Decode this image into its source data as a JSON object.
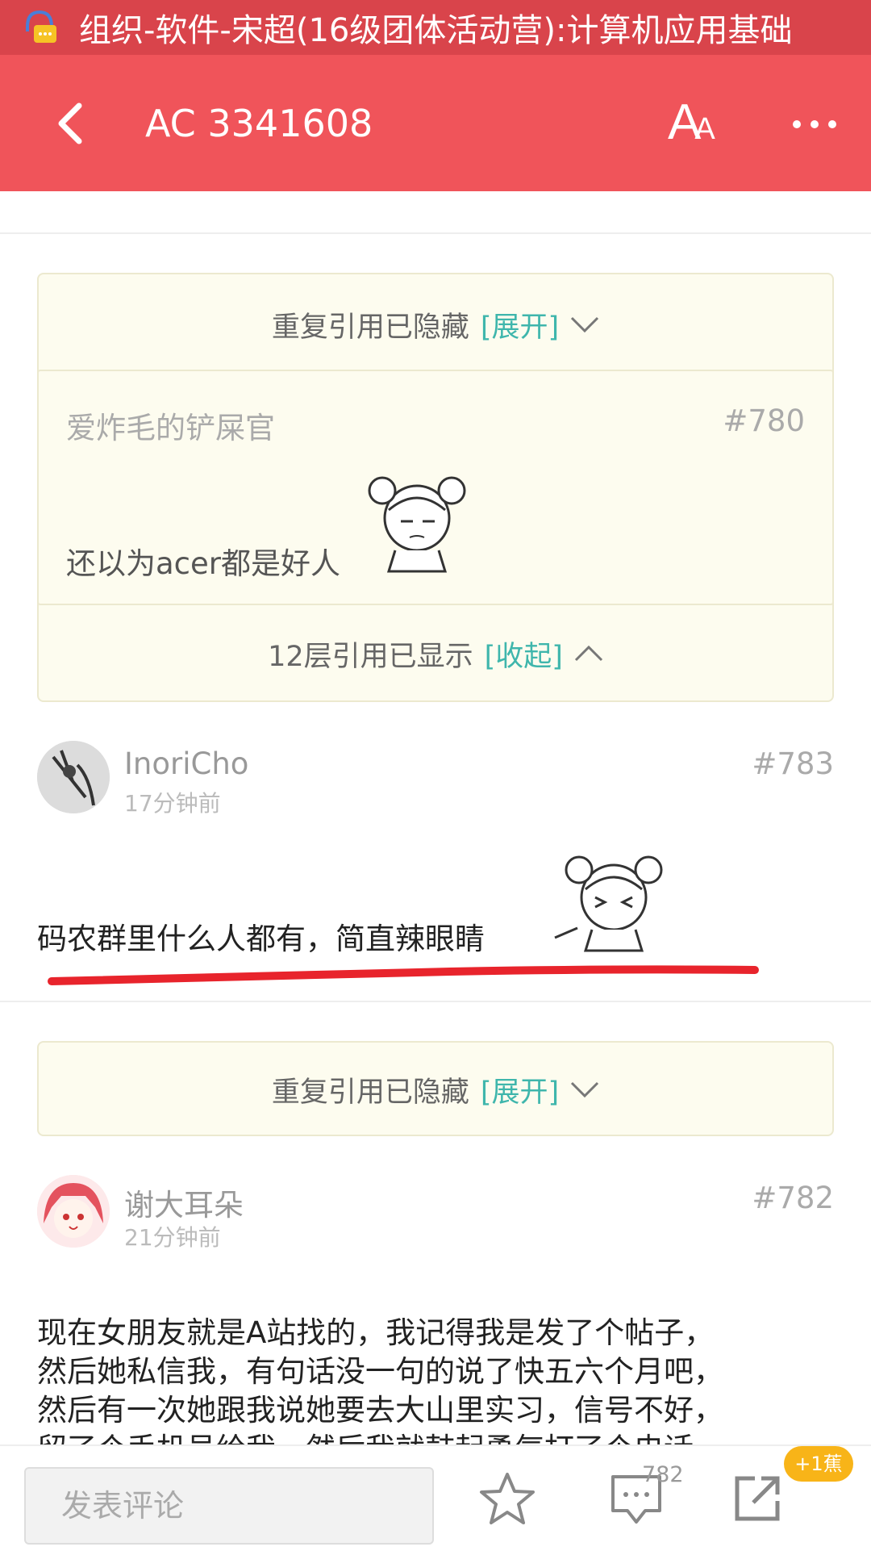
{
  "notification": {
    "text": "组织-软件-宋超(16级团体活动营):计算机应用基础"
  },
  "header": {
    "title": "AC 3341608",
    "font_icon_text": "A",
    "font_icon_sub": "A"
  },
  "quote_block_1": {
    "hidden_text": "重复引用已隐藏",
    "expand_link": "[展开]",
    "quoted": {
      "author": "爱炸毛的铲屎官",
      "floor": "#780",
      "body": "还以为acer都是好人"
    },
    "shown_text": "12层引用已显示",
    "collapse_link": "[收起]"
  },
  "comments": [
    {
      "name": "InoriCho",
      "time": "17分钟前",
      "floor": "#783",
      "text": "码农群里什么人都有，简直辣眼睛"
    },
    {
      "name": "谢大耳朵",
      "time": "21分钟前",
      "floor": "#782",
      "lines": [
        "现在女朋友就是A站找的，我记得我是发了个帖子，",
        "然后她私信我，有句话没一句的说了快五六个月吧，",
        "然后有一次她跟我说她要去大山里实习，信号不好，",
        "留了个手机号给我，然后我就鼓起勇气打了个电话"
      ]
    }
  ],
  "quote_block_2": {
    "hidden_text": "重复引用已隐藏",
    "expand_link": "[展开]"
  },
  "bottom_bar": {
    "comment_placeholder": "发表评论",
    "comment_count": "782",
    "banana_badge": "+1蕉"
  },
  "colors": {
    "header": "#f0545a",
    "notification": "#d9444b",
    "link": "#3fb6ac",
    "quote_bg": "#fdfcef",
    "badge": "#f8b418",
    "underline": "#e8242c"
  }
}
